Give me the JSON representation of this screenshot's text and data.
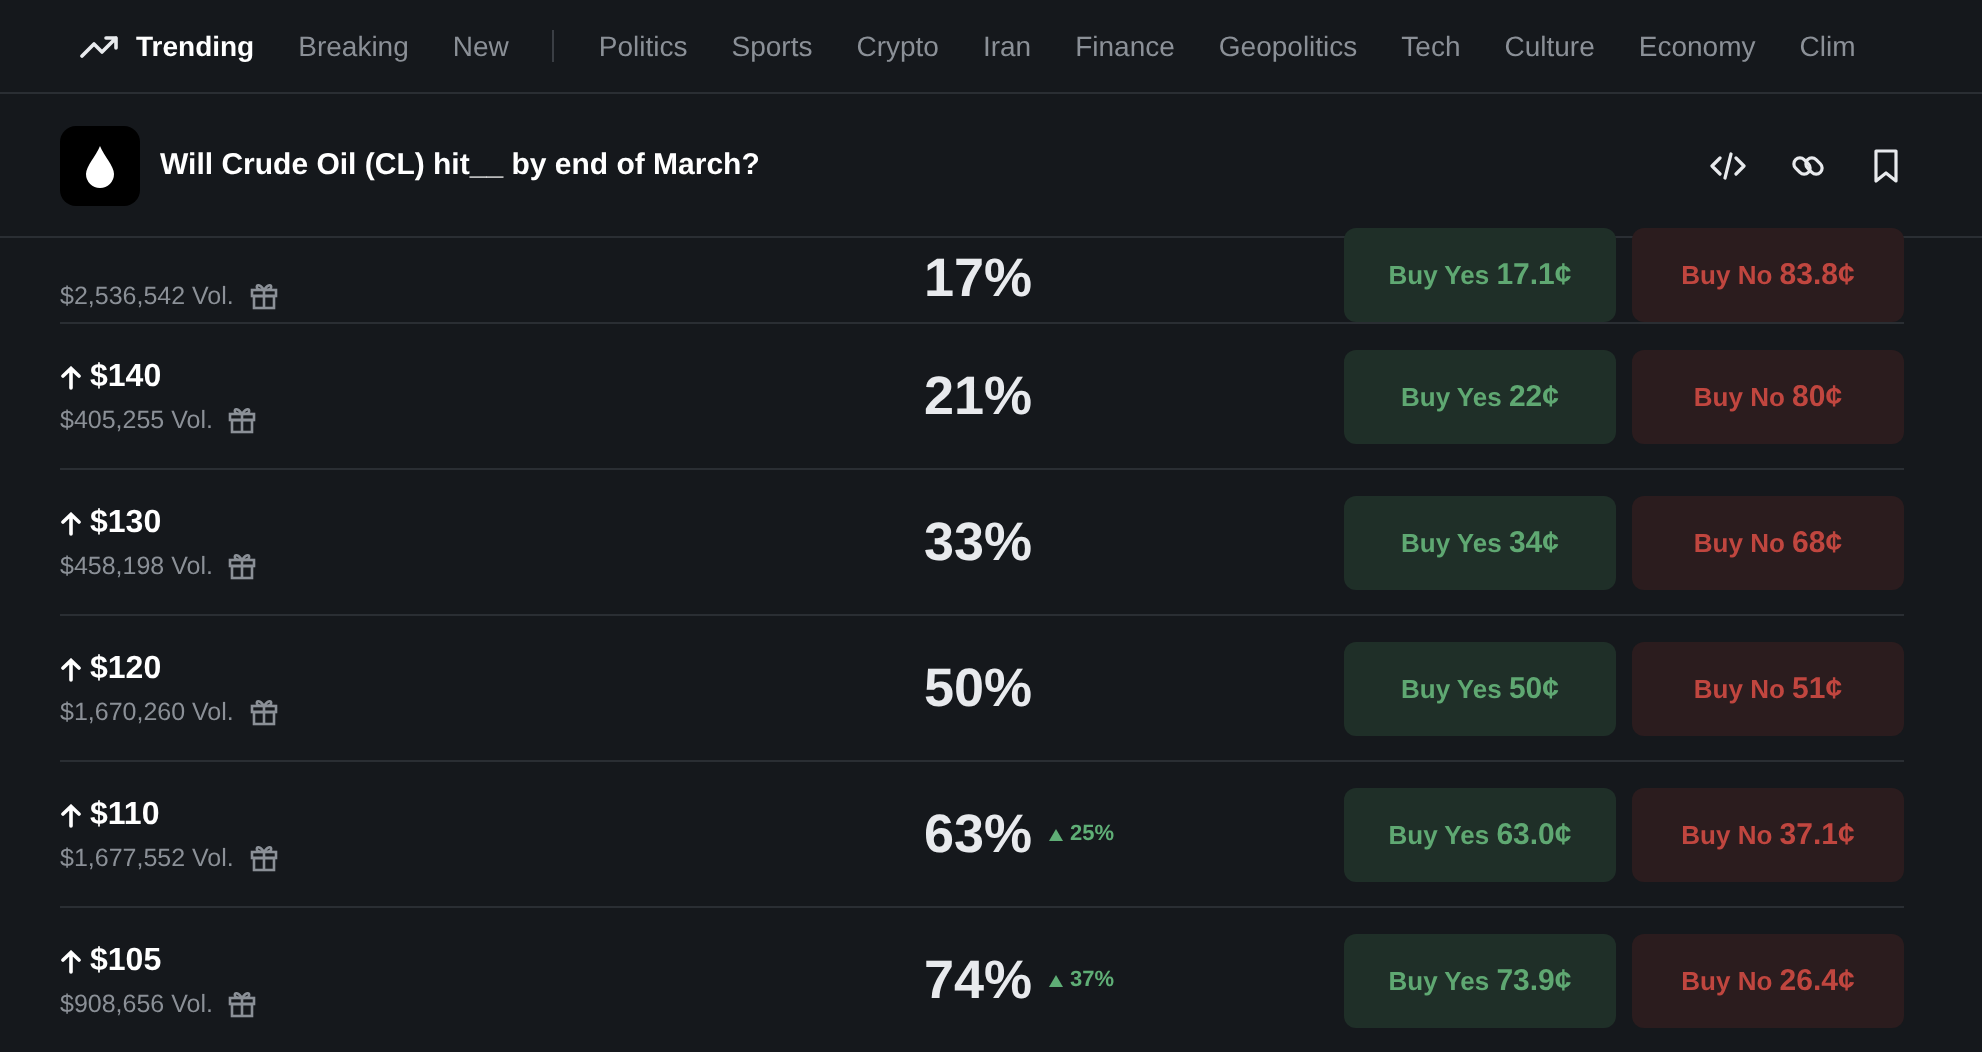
{
  "nav": {
    "primary": [
      {
        "label": "Trending",
        "selected": true,
        "kind": "trending"
      },
      {
        "label": "Breaking",
        "selected": false
      },
      {
        "label": "New",
        "selected": false
      }
    ],
    "categories": [
      {
        "label": "Politics",
        "selected": false
      },
      {
        "label": "Sports",
        "selected": false
      },
      {
        "label": "Crypto",
        "selected": false
      },
      {
        "label": "Iran",
        "selected": false
      },
      {
        "label": "Finance",
        "selected": false
      },
      {
        "label": "Geopolitics",
        "selected": false
      },
      {
        "label": "Tech",
        "selected": false
      },
      {
        "label": "Culture",
        "selected": false
      },
      {
        "label": "Economy",
        "selected": false
      },
      {
        "label": "Clim",
        "selected": false
      }
    ]
  },
  "event": {
    "title": "Will Crude Oil (CL) hit__ by end of March?"
  },
  "markets": [
    {
      "volume": "$2,536,542 Vol.",
      "chance": "17%",
      "yes_label": "Buy Yes",
      "yes_price": "17.1¢",
      "no_label": "Buy No",
      "no_price": "83.8¢"
    },
    {
      "label": "$140",
      "volume": "$405,255 Vol.",
      "chance": "21%",
      "yes_label": "Buy Yes",
      "yes_price": "22¢",
      "no_label": "Buy No",
      "no_price": "80¢"
    },
    {
      "label": "$130",
      "volume": "$458,198 Vol.",
      "chance": "33%",
      "yes_label": "Buy Yes",
      "yes_price": "34¢",
      "no_label": "Buy No",
      "no_price": "68¢"
    },
    {
      "label": "$120",
      "volume": "$1,670,260 Vol.",
      "chance": "50%",
      "yes_label": "Buy Yes",
      "yes_price": "50¢",
      "no_label": "Buy No",
      "no_price": "51¢"
    },
    {
      "label": "$110",
      "volume": "$1,677,552 Vol.",
      "chance": "63%",
      "change": "25%",
      "yes_label": "Buy Yes",
      "yes_price": "63.0¢",
      "no_label": "Buy No",
      "no_price": "37.1¢"
    },
    {
      "label": "$105",
      "volume": "$908,656 Vol.",
      "chance": "74%",
      "change": "37%",
      "yes_label": "Buy Yes",
      "yes_price": "73.9¢",
      "no_label": "Buy No",
      "no_price": "26.4¢"
    }
  ]
}
